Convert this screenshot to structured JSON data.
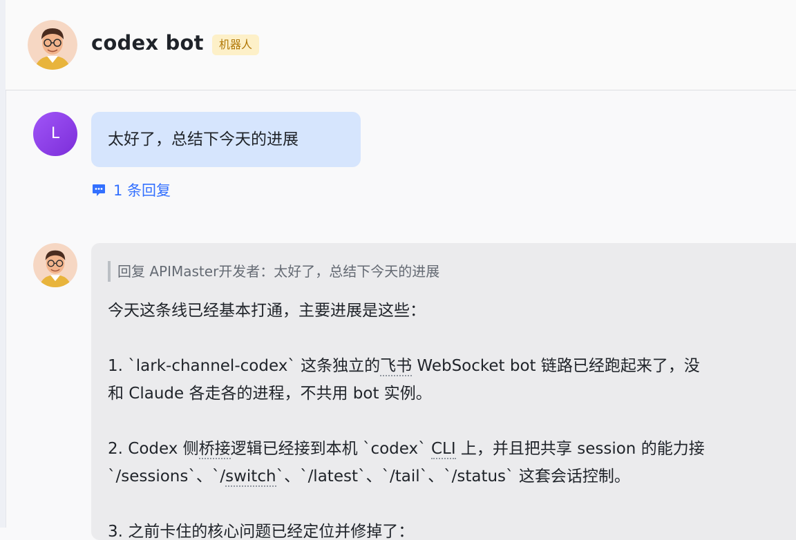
{
  "header": {
    "bot_name": "codex bot",
    "badge": "机器人"
  },
  "user_message": {
    "avatar_letter": "L",
    "text": "太好了，总结下今天的进展"
  },
  "reply_link": {
    "label": "1 条回复"
  },
  "bot_message": {
    "quote": "回复 APIMaster开发者：太好了，总结下今天的进展",
    "lines": [
      "今天这条线已经基本打通，主要进展是这些：",
      "1. `lark-channel-codex` 这条独立的",
      "飞书",
      " WebSocket bot 链路已经跑起来了，没",
      "和 Claude 各走各的进程，不共用 bot 实例。",
      "2. Codex 侧",
      "桥接",
      "逻辑已经接到本机 `codex` ",
      "CLI",
      " 上，并且把共享 session 的能力接",
      "`/sessions`、`/",
      "switch",
      "`、`/latest`、`/tail`、`/status` 这套会话控制。",
      "3. 之前卡住的核心问题已经定位并修掉了："
    ]
  },
  "colors": {
    "accent": "#3370ff",
    "user_bubble": "#d6e5fd",
    "bot_bubble": "#ebebed",
    "badge_bg": "#fdf0c8",
    "badge_text": "#b07705"
  },
  "icons": {
    "reply": "comment-bubble-icon"
  }
}
